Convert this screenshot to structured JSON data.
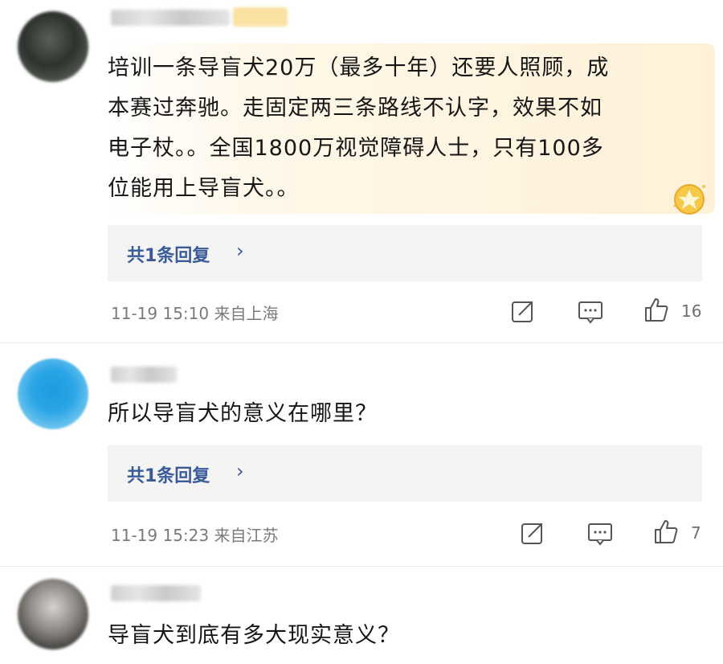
{
  "comments": [
    {
      "text_lines": [
        "培训一条导盲犬20万（最多十年）还要人照顾，成",
        "本赛过奔驰。走固定两三条路线不认字，效果不如",
        "电子杖。。全国1800万视觉障碍人士，只有100多",
        "位能用上导盲犬。。"
      ],
      "reply_label": "共1条回复",
      "reply_chevron": "›",
      "meta": "11-19 15:10 来自上海",
      "likes": "16"
    },
    {
      "text": "所以导盲犬的意义在哪里？",
      "reply_label": "共1条回复",
      "reply_chevron": "›",
      "meta": "11-19 15:23 来自江苏",
      "likes": "7"
    },
    {
      "text": "导盲犬到底有多大现实意义？"
    }
  ],
  "icons": {
    "share": "share-icon",
    "comment": "comment-icon",
    "like": "like-icon",
    "medal": "medal-icon"
  },
  "colors": {
    "link": "#3a5a99",
    "meta": "#7a7a7a",
    "reply_bg": "#f4f4f4",
    "highlight": "#fff3dd"
  }
}
